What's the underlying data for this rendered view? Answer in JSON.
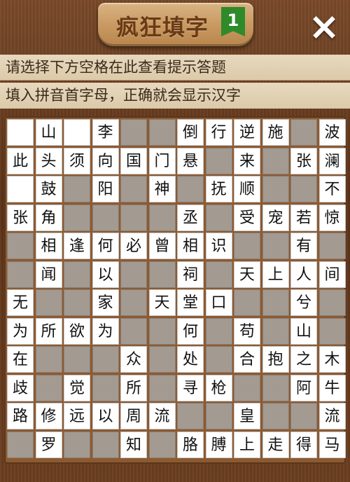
{
  "header": {
    "title": "疯狂填字",
    "level": "1",
    "close_icon": "×"
  },
  "hints": [
    "请选择下方空格在此查看提示答题",
    "填入拼音首字母，正确就会显示汉字"
  ],
  "grid": {
    "rows": [
      [
        "",
        "山",
        "",
        "李",
        "",
        "",
        "倒",
        "行",
        "逆",
        "施",
        "",
        "波"
      ],
      [
        "此",
        "头",
        "须",
        "向",
        "国",
        "门",
        "悬",
        "",
        "来",
        "",
        "张",
        "澜"
      ],
      [
        "",
        "鼓",
        "",
        "阳",
        "",
        "神",
        "",
        "抚",
        "顺",
        "",
        "",
        "不"
      ],
      [
        "张",
        "角",
        "",
        "",
        "",
        "",
        "丞",
        "",
        "受",
        "宠",
        "若",
        "惊"
      ],
      [
        "",
        "相",
        "逢",
        "何",
        "必",
        "曾",
        "相",
        "识",
        "",
        "",
        "有",
        ""
      ],
      [
        "",
        "闻",
        "",
        "以",
        "",
        "",
        "祠",
        "",
        "天",
        "上",
        "人",
        "间"
      ],
      [
        "无",
        "",
        "",
        "家",
        "",
        "天",
        "堂",
        "口",
        "",
        "",
        "兮",
        ""
      ],
      [
        "为",
        "所",
        "欲",
        "为",
        "",
        "",
        "何",
        "",
        "苟",
        "",
        "山",
        ""
      ],
      [
        "在",
        "",
        "",
        "",
        "众",
        "",
        "处",
        "",
        "合",
        "抱",
        "之",
        "木"
      ],
      [
        "歧",
        "",
        "觉",
        "",
        "所",
        "",
        "寻",
        "枪",
        "",
        "",
        "阿",
        "牛"
      ],
      [
        "路",
        "修",
        "远",
        "以",
        "周",
        "流",
        "",
        "",
        "皇",
        "",
        "",
        "流"
      ],
      [
        "",
        "罗",
        "",
        "",
        "知",
        "",
        "胳",
        "膊",
        "上",
        "走",
        "得",
        "马"
      ]
    ],
    "cell_types": [
      "WWWWGGWWWWGW",
      "WWWWWWWGWGWW",
      "WWGWGWGWWGGW",
      "WWGGGGWGWWWW",
      "GWWWWWWWGGWG",
      "GWGWGGWGWWWW",
      "WGGWGWWWGGWG",
      "WWWWGGWGWGWG",
      "WGGGWGWGWWWW",
      "WGWGWGWWGGWW",
      "WWWWWWGGWGGW",
      "GWGGWGWWWWWW"
    ]
  }
}
